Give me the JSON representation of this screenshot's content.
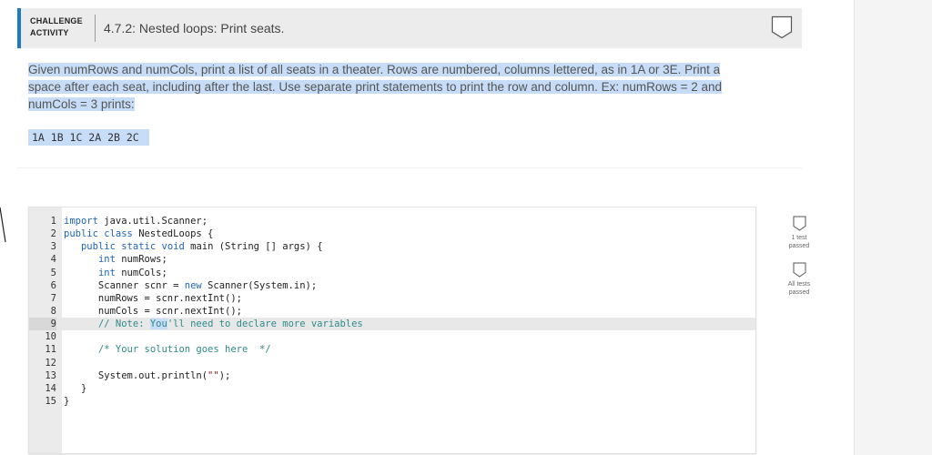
{
  "header": {
    "activity_type_line1": "CHALLENGE",
    "activity_type_line2": "ACTIVITY",
    "title": "4.7.2: Nested loops: Print seats."
  },
  "prompt": {
    "text": "Given numRows and numCols, print a list of all seats in a theater. Rows are numbered, columns lettered, as in 1A or 3E. Print a space after each seat, including after the last. Use separate print statements to print the row and column. Ex: numRows = 2 and numCols = 3 prints:",
    "example_output": "1A 1B 1C 2A 2B 2C "
  },
  "editor": {
    "active_line": 9,
    "lines": [
      {
        "num": "1",
        "code": "import java.util.Scanner;"
      },
      {
        "num": "2",
        "code": "public class NestedLoops {"
      },
      {
        "num": "3",
        "code": "   public static void main (String [] args) {"
      },
      {
        "num": "4",
        "code": "      int numRows;"
      },
      {
        "num": "5",
        "code": "      int numCols;"
      },
      {
        "num": "6",
        "code": "      Scanner scnr = new Scanner(System.in);"
      },
      {
        "num": "7",
        "code": "      numRows = scnr.nextInt();"
      },
      {
        "num": "8",
        "code": "      numCols = scnr.nextInt();"
      },
      {
        "num": "9",
        "code": "      // Note: You'll need to declare more variables"
      },
      {
        "num": "10",
        "code": ""
      },
      {
        "num": "11",
        "code": "      /* Your solution goes here  */"
      },
      {
        "num": "12",
        "code": ""
      },
      {
        "num": "13",
        "code": "      System.out.println(\"\");"
      },
      {
        "num": "14",
        "code": "   }"
      },
      {
        "num": "15",
        "code": "}"
      }
    ]
  },
  "tests": [
    {
      "label": "1 test passed",
      "icon": "shield-outline-icon"
    },
    {
      "label": "All tests passed",
      "icon": "shield-outline-icon"
    }
  ],
  "colors": {
    "accent": "#1f7ac4",
    "selection": "#c7dcf7",
    "keyword": "#1f64b8",
    "comment": "#2f8a8a",
    "string": "#a31515"
  }
}
